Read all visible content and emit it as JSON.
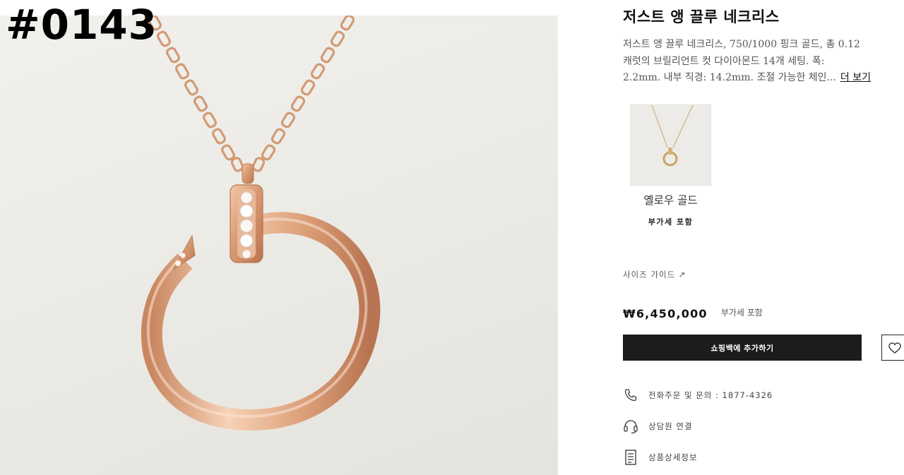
{
  "stamp": "#0143",
  "product": {
    "title": "저스트 앵 끌루 네크리스",
    "description_lines": [
      "저스트 앵 끌루 네크리스, 750/1000 핑크 골드, 총 0.12",
      "캐럿의 브릴리언트 컷 다이아몬드 14개 세팅. 폭:",
      "2.2mm. 내부 직경: 14.2mm. 조절 가능한 체인..."
    ],
    "more_label": "더 보기",
    "variant": {
      "label": "옐로우 골드",
      "tax_note": "부가세 포함"
    },
    "size_guide": "사이즈 가이드 ↗",
    "price": "₩6,450,000",
    "price_tax": "부가세 포함",
    "add_to_bag": "쇼핑백에 추가하기"
  },
  "contacts": [
    {
      "icon": "phone-icon",
      "label": "전화주문 및 문의 : 1877-4326"
    },
    {
      "icon": "headset-icon",
      "label": "상담원 연결"
    },
    {
      "icon": "document-icon",
      "label": "상품상세정보"
    }
  ],
  "colors": {
    "rose_gold": "#d9a07a",
    "button_dark": "#1c1c1c"
  }
}
